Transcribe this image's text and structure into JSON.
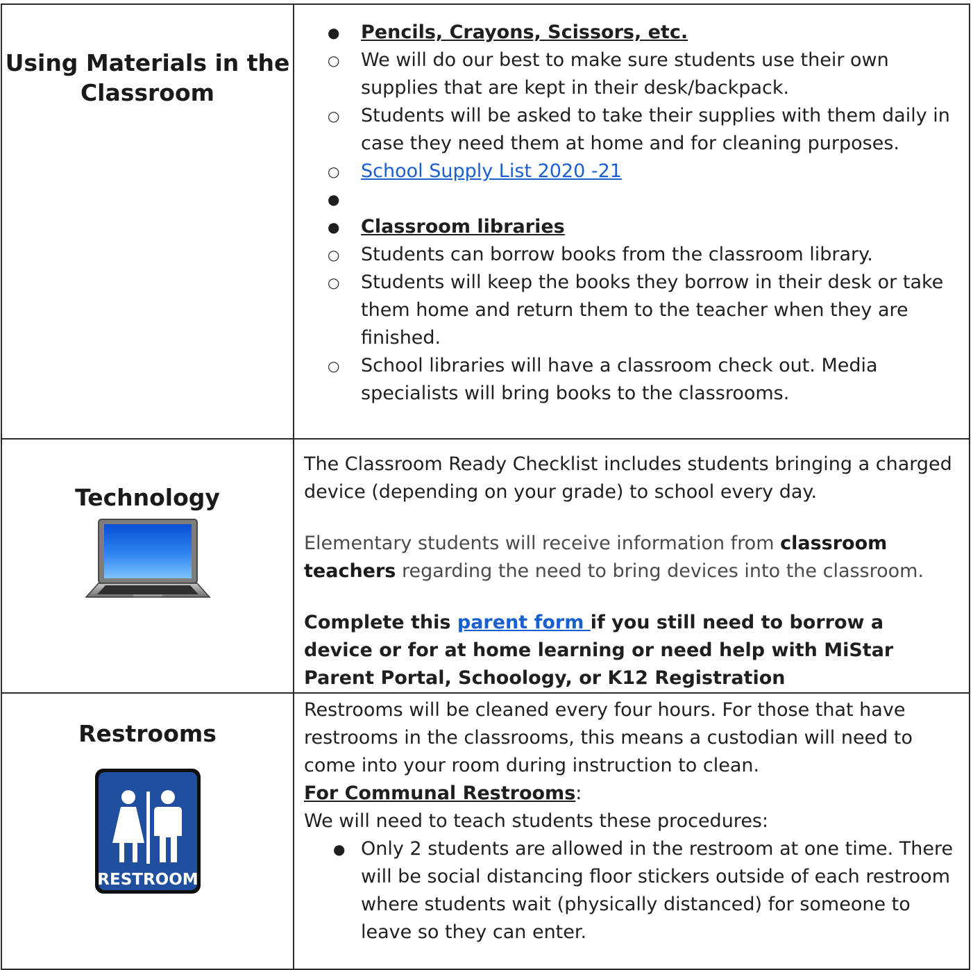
{
  "materials": {
    "heading_line1": "Using Materials in the",
    "heading_line2": "Classroom",
    "sections": [
      {
        "title": "Pencils, Crayons, Scissors, etc.",
        "items": [
          "We will do our best to make sure students use their own supplies that are kept in their desk/backpack.",
          "Students will be asked to take their supplies with them daily in case they need them at home and for cleaning purposes."
        ],
        "link_text": "School Supply List 2020 -21"
      },
      {
        "title": "Classroom libraries",
        "items": [
          "Students can borrow books from the classroom library.",
          "Students will keep the books they borrow in their desk or take them home and return them to the teacher when they are finished.",
          "School libraries will have a classroom check out. Media specialists will bring books to the classrooms."
        ]
      }
    ]
  },
  "technology": {
    "heading": "Technology",
    "para1": "The Classroom Ready Checklist includes students bringing a charged device (depending on your grade) to school every day.",
    "para2_pre": "Elementary students will receive information from ",
    "para2_bold": "classroom teachers",
    "para2_post": " regarding the need to bring devices into the classroom.",
    "para3_pre": "Complete this ",
    "para3_link": "parent form ",
    "para3_post": "if you still need to borrow a device or for at home learning or need help with MiStar Parent Portal, Schoology, or K12 Registration"
  },
  "restrooms": {
    "heading": "Restrooms",
    "sign_text": "RESTROOM",
    "para1": "Restrooms will be cleaned every four hours.  For those that have restrooms in the classrooms, this means a custodian will need to come into your room during instruction to clean.",
    "sub_heading": "For Communal Restrooms",
    "sub_heading_suffix": ":",
    "intro": "We will need to teach students these procedures:",
    "bullets": [
      "Only 2 students are allowed in the restroom at one time. There will be social distancing floor stickers outside of each restroom where students wait (physically distanced) for someone to leave so they can enter."
    ]
  },
  "colors": {
    "link": "#1a5fd0",
    "border": "#2b2b2b",
    "sign_blue": "#1f4f9e"
  }
}
